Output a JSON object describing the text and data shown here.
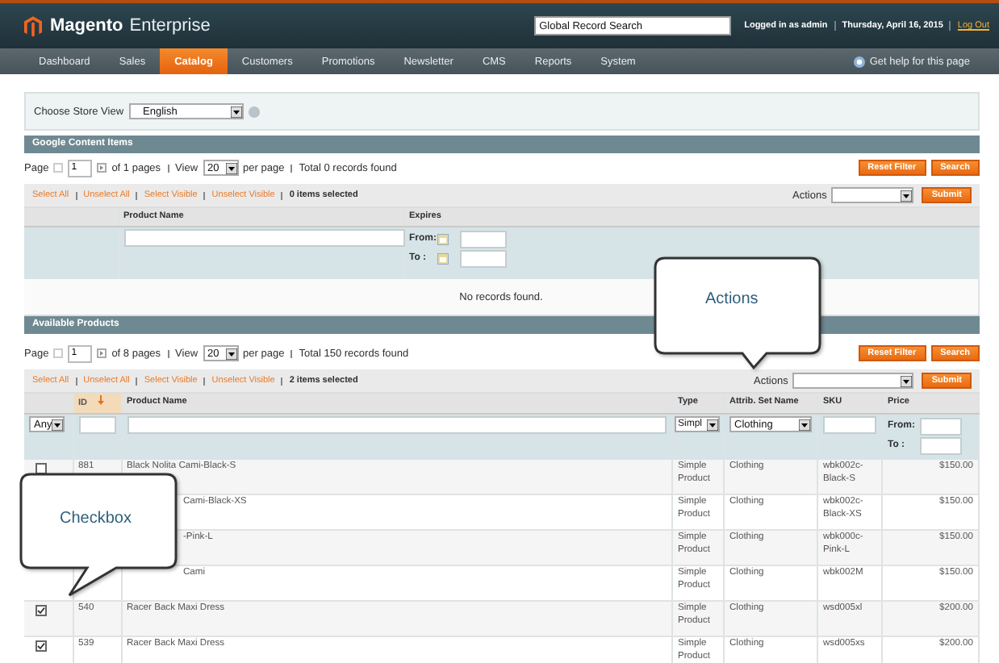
{
  "header": {
    "logo": "Magento",
    "edition": "Enterprise",
    "search_placeholder": "Global Record Search",
    "user": "Logged in as admin",
    "date": "Thursday, April 16, 2015",
    "logout": "Log Out"
  },
  "nav": {
    "items": [
      {
        "label": "Dashboard",
        "selected": false
      },
      {
        "label": "Sales",
        "selected": false
      },
      {
        "label": "Catalog",
        "selected": true
      },
      {
        "label": "Customers",
        "selected": false
      },
      {
        "label": "Promotions",
        "selected": false
      },
      {
        "label": "Newsletter",
        "selected": false
      },
      {
        "label": "CMS",
        "selected": false
      },
      {
        "label": "Reports",
        "selected": false
      },
      {
        "label": "System",
        "selected": false
      }
    ],
    "help": "Get help for this page"
  },
  "store_view": {
    "label": "Choose Store View",
    "value": "English"
  },
  "google": {
    "title": "Google Content Items",
    "pager": {
      "page_label": "Page",
      "page": "1",
      "of": "of 1 pages",
      "view": "View",
      "per_page": "20",
      "per_page_label": "per page",
      "total": "Total 0 records found"
    },
    "buttons": [
      "Reset Filter",
      "Search"
    ],
    "mass": {
      "links": [
        "Select All",
        "Unselect All",
        "Select Visible",
        "Unselect Visible"
      ],
      "selected": "0 items selected",
      "actions_label": "Actions",
      "submit": "Submit"
    },
    "columns": [
      "Product Name",
      "Expires"
    ],
    "from": "From:",
    "to": "To :",
    "empty": "No records found."
  },
  "products": {
    "title": "Available Products",
    "pager": {
      "page_label": "Page",
      "page": "1",
      "of": "of 8 pages",
      "view": "View",
      "per_page": "20",
      "per_page_label": "per page",
      "total": "Total 150 records found"
    },
    "buttons": [
      "Reset Filter",
      "Search"
    ],
    "mass": {
      "links": [
        "Select All",
        "Unselect All",
        "Select Visible",
        "Unselect Visible"
      ],
      "selected": "2 items selected",
      "actions_label": "Actions",
      "submit": "Submit"
    },
    "columns": [
      {
        "label": "ID",
        "sorted": true
      },
      {
        "label": "Product Name",
        "sorted": false
      },
      {
        "label": "Type",
        "sorted": false
      },
      {
        "label": "Attrib. Set Name",
        "sorted": false
      },
      {
        "label": "SKU",
        "sorted": false
      },
      {
        "label": "Price",
        "sorted": false
      }
    ],
    "filter": {
      "any": "Any",
      "type": "Simpl",
      "attrib": "Clothing",
      "from": "From:",
      "to": "To :"
    },
    "rows": [
      {
        "kind": "full",
        "checked": false,
        "id": "881",
        "name": "Black Nolita Cami-Black-S",
        "type": "Simple Product",
        "attrib": "Clothing",
        "sku": "wbk002c-Black-S",
        "price": "$150.00"
      },
      {
        "kind": "covered",
        "name": "Cami-Black-XS",
        "type": "Simple Product",
        "attrib": "Clothing",
        "sku": "wbk002c-Black-XS",
        "price": "$150.00"
      },
      {
        "kind": "covered",
        "name": "-Pink-L",
        "type": "Simple Product",
        "attrib": "Clothing",
        "sku": "wbk000c-Pink-L",
        "price": "$150.00"
      },
      {
        "kind": "covered",
        "name": "Cami",
        "type": "Simple Product",
        "attrib": "Clothing",
        "sku": "wbk002M",
        "price": "$150.00"
      },
      {
        "kind": "full",
        "checked": true,
        "id": "540",
        "name": "Racer Back Maxi Dress",
        "type": "Simple Product",
        "attrib": "Clothing",
        "sku": "wsd005xl",
        "price": "$200.00"
      },
      {
        "kind": "full",
        "checked": true,
        "id": "539",
        "name": "Racer Back Maxi Dress",
        "type": "Simple Product",
        "attrib": "Clothing",
        "sku": "wsd005xs",
        "price": "$200.00"
      }
    ]
  },
  "callouts": [
    {
      "text": "Actions"
    },
    {
      "text": "Checkbox"
    }
  ]
}
